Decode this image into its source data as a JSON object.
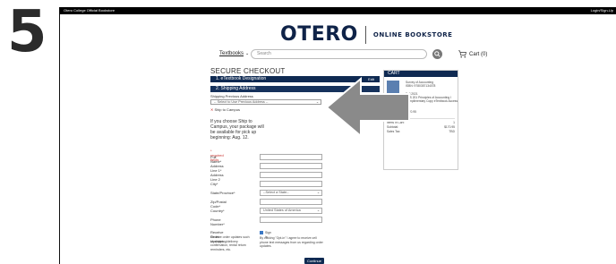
{
  "step_number": "5",
  "topbar": {
    "left": "Otero College Official Bookstore",
    "right": "Login/Sign-Up"
  },
  "logo": {
    "brand": "OTERO",
    "sub": "ONLINE BOOKSTORE"
  },
  "nav": {
    "textbooks": "Textbooks",
    "search_placeholder": "Search",
    "cart_label": "Cart (0)"
  },
  "checkout": {
    "title": "SECURE CHECKOUT",
    "step1": "1. eTextbook Designation",
    "step1_edit": "Edit",
    "step2": "2. Shipping Address",
    "prev_address_label": "Shipping Previous Address",
    "prev_address_value": "-- Select to Use Previous Address --",
    "ship_to_campus": "Ship to Campus",
    "info": "If you choose Ship to Campus, your package will be available for pick up beginning: Aug. 12.",
    "required": "* required fields",
    "fields": [
      {
        "label": "Full Name*",
        "value": ""
      },
      {
        "label": "Address Line 1*",
        "value": ""
      },
      {
        "label": "Address Line 2",
        "value": ""
      },
      {
        "label": "City*",
        "value": ""
      },
      {
        "label": "State/Province*",
        "value": "--Select a State--"
      },
      {
        "label": "Zip/Postal Code*",
        "value": ""
      },
      {
        "label": "Country*",
        "value": "United States of America"
      },
      {
        "label": "Phone Number*",
        "value": ""
      }
    ],
    "order_updates_label": "Receive Order Updates",
    "order_updates_desc": "Receive order updates such as shipping/delivery confirmation, rental return reminders, etc.",
    "sign_in": "Sign in",
    "optin_text": "By clicking \"Opt-in\" I agree to receive cell phone text messages from us regarding order updates.",
    "continue": "Continue"
  },
  "cart": {
    "title": "CART",
    "item_title": "Survey of Accounting",
    "item_isbn": "ISBN: 9780357134078",
    "item_term": "Fall 2021",
    "item_course": "BUS 201 Principles of Accounting I",
    "item_condition": "Complimentary Copy eTextbook Access",
    "quantity_label": "Quantity:",
    "quantity": "1",
    "price_label": "Price:",
    "price": "$170.95",
    "items_label": "Items in Cart:",
    "items": "1",
    "subtotal_label": "Subtotal:",
    "subtotal": "$170.95",
    "tax_label": "Sales Tax:",
    "tax": "TBD"
  },
  "colors": {
    "navy": "#0f2a52",
    "arrow": "#8a8a8a",
    "required": "#c9302c"
  }
}
